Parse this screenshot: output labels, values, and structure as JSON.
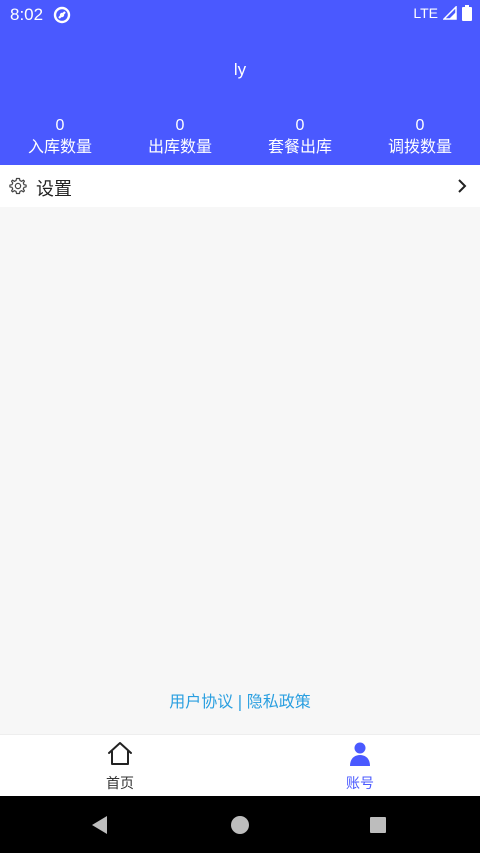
{
  "status_bar": {
    "time": "8:02",
    "network": "LTE"
  },
  "profile": {
    "username": "ly"
  },
  "stats": [
    {
      "value": "0",
      "label": "入库数量"
    },
    {
      "value": "0",
      "label": "出库数量"
    },
    {
      "value": "0",
      "label": "套餐出库"
    },
    {
      "value": "0",
      "label": "调拨数量"
    }
  ],
  "settings": {
    "label": "设置"
  },
  "footer": {
    "user_agreement": "用户协议",
    "separator": "|",
    "privacy_policy": "隐私政策"
  },
  "tabs": [
    {
      "label": "首页",
      "icon": "home-icon",
      "active": false
    },
    {
      "label": "账号",
      "icon": "person-icon",
      "active": true
    }
  ],
  "colors": {
    "primary": "#4a59ff",
    "link": "#2a9fe0",
    "background": "#f7f7f7"
  }
}
